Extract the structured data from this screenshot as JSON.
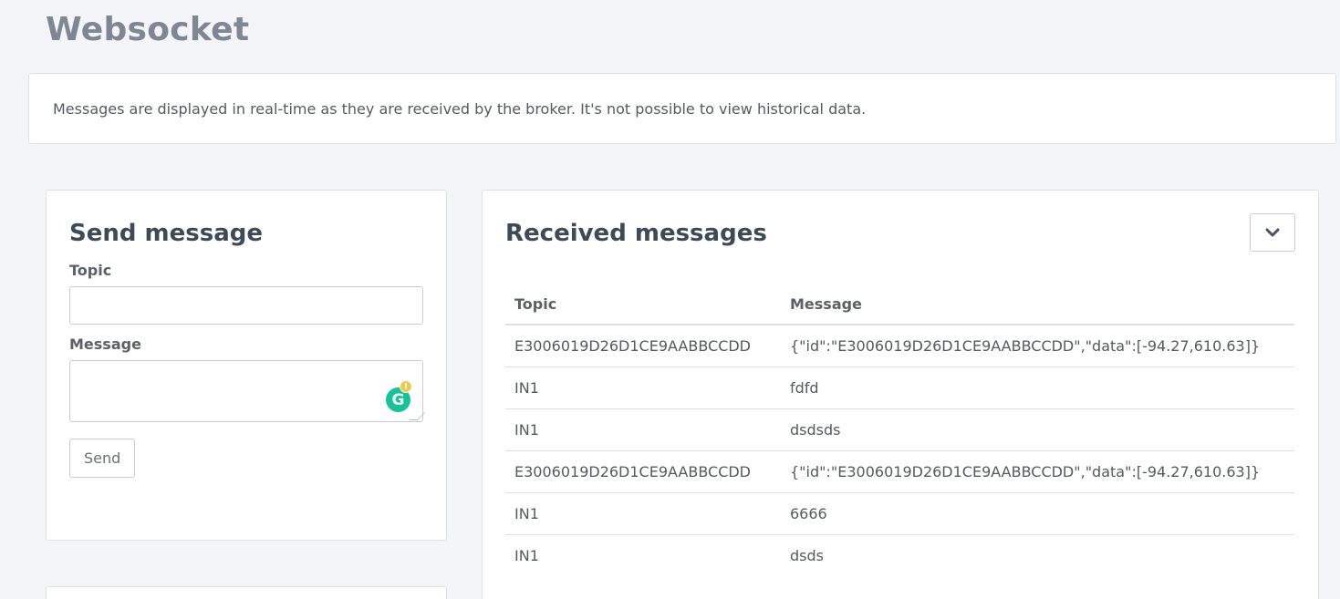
{
  "page": {
    "title": "Websocket"
  },
  "info": {
    "text": "Messages are displayed in real-time as they are received by the broker. It's not possible to view historical data."
  },
  "send": {
    "title": "Send message",
    "topic_label": "Topic",
    "topic_value": "",
    "message_label": "Message",
    "message_value": "",
    "send_label": "Send"
  },
  "received": {
    "title": "Received messages",
    "collapse_icon": "chevron-down-icon",
    "columns": [
      "Topic",
      "Message"
    ],
    "rows": [
      {
        "topic": "E3006019D26D1CE9AABBCCDD",
        "message": "{\"id\":\"E3006019D26D1CE9AABBCCDD\",\"data\":[-94.27,610.63]}"
      },
      {
        "topic": "IN1",
        "message": "fdfd"
      },
      {
        "topic": "IN1",
        "message": "dsdsds"
      },
      {
        "topic": "E3006019D26D1CE9AABBCCDD",
        "message": "{\"id\":\"E3006019D26D1CE9AABBCCDD\",\"data\":[-94.27,610.63]}"
      },
      {
        "topic": "IN1",
        "message": "6666"
      },
      {
        "topic": "IN1",
        "message": "dsds"
      }
    ]
  },
  "colors": {
    "background": "#f4f5f9",
    "title": "#7f8794",
    "heading": "#3d4a57",
    "grammarly": "#15c39a",
    "grammarly_alert": "#f2c94c"
  }
}
